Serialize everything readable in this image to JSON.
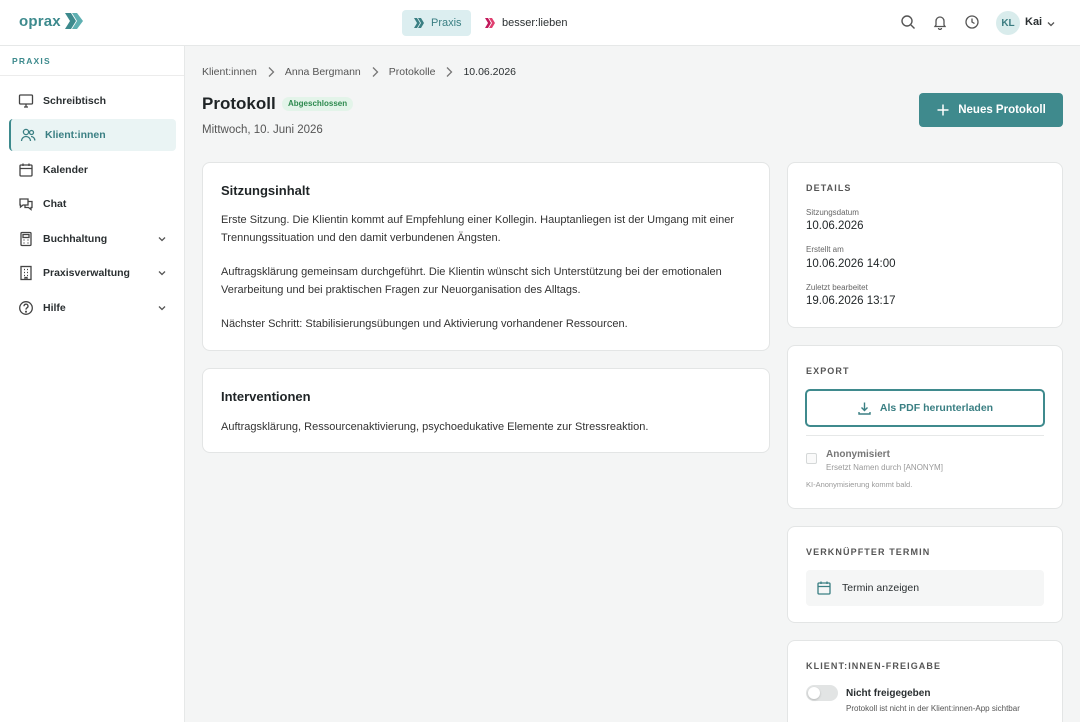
{
  "brand": {
    "name": "oprax"
  },
  "topbar": {
    "apps": [
      {
        "label": "Praxis",
        "active": true
      },
      {
        "label": "besser:lieben",
        "active": false
      }
    ],
    "icons": [
      "search-icon",
      "bell-icon",
      "clock-icon"
    ],
    "user": {
      "initials": "KL",
      "name": "Kai"
    }
  },
  "sidebar": {
    "section_title": "PRAXIS",
    "items": [
      {
        "label": "Schreibtisch",
        "icon": "monitor-icon",
        "active": false,
        "expandable": false
      },
      {
        "label": "Klient:innen",
        "icon": "users-icon",
        "active": true,
        "expandable": false
      },
      {
        "label": "Kalender",
        "icon": "calendar-icon",
        "active": false,
        "expandable": false
      },
      {
        "label": "Chat",
        "icon": "chat-icon",
        "active": false,
        "expandable": false
      },
      {
        "label": "Buchhaltung",
        "icon": "calculator-icon",
        "active": false,
        "expandable": true
      },
      {
        "label": "Praxisverwaltung",
        "icon": "building-icon",
        "active": false,
        "expandable": true
      },
      {
        "label": "Hilfe",
        "icon": "help-icon",
        "active": false,
        "expandable": true
      }
    ]
  },
  "breadcrumb": [
    "Klient:innen",
    "Anna Bergmann",
    "Protokolle",
    "10.06.2026"
  ],
  "page": {
    "title": "Protokoll",
    "status": "Abgeschlossen",
    "date": "Mittwoch, 10. Juni 2026",
    "new_button": "Neues Protokoll"
  },
  "session": {
    "title": "Sitzungsinhalt",
    "paragraphs": [
      "Erste Sitzung. Die Klientin kommt auf Empfehlung einer Kollegin. Hauptanliegen ist der Umgang mit einer Trennungssituation und den damit verbundenen Ängsten.",
      "Auftragsklärung gemeinsam durchgeführt. Die Klientin wünscht sich Unterstützung bei der emotionalen Verarbeitung und bei praktischen Fragen zur Neuorganisation des Alltags.",
      "Nächster Schritt: Stabilisierungsübungen und Aktivierung vorhandener Ressourcen."
    ]
  },
  "interventions": {
    "title": "Interventionen",
    "text": "Auftragsklärung, Ressourcenaktivierung, psychoedukative Elemente zur Stressreaktion."
  },
  "details": {
    "title": "DETAILS",
    "fields": [
      {
        "label": "Sitzungsdatum",
        "value": "10.06.2026"
      },
      {
        "label": "Erstellt am",
        "value": "10.06.2026 14:00"
      },
      {
        "label": "Zuletzt bearbeitet",
        "value": "19.06.2026 13:17"
      }
    ]
  },
  "export": {
    "title": "EXPORT",
    "pdf_button": "Als PDF herunterladen",
    "anonymize_label": "Anonymisiert",
    "anonymize_sub": "Ersetzt Namen durch [ANONYM]",
    "anonymize_checked": false,
    "note": "KI-Anonymisierung kommt bald."
  },
  "appointment": {
    "title": "VERKNÜPFTER TERMIN",
    "link": "Termin anzeigen"
  },
  "sharing": {
    "title": "KLIENT:INNEN-FREIGABE",
    "enabled": false,
    "label": "Nicht freigegeben",
    "sub": "Protokoll ist nicht in der Klient:innen-App sichtbar"
  },
  "colors": {
    "accent": "#3f8a8d",
    "accent_light": "#dceef0",
    "success_bg": "#e3f4e9",
    "success_text": "#2d8a4e",
    "brand_secondary": "#c2185b"
  }
}
